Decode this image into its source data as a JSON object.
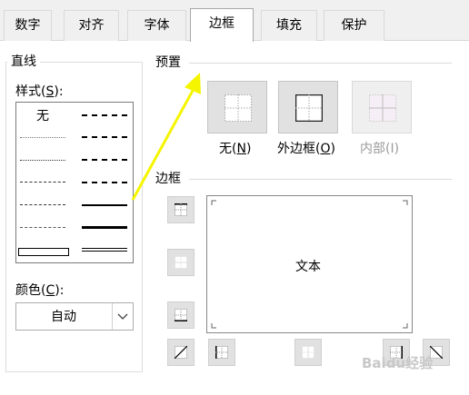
{
  "tabs": [
    {
      "label": "数字"
    },
    {
      "label": "对齐"
    },
    {
      "label": "字体"
    },
    {
      "label": "边框"
    },
    {
      "label": "填充"
    },
    {
      "label": "保护"
    }
  ],
  "active_tab": "边框",
  "line_group": {
    "title": "直线",
    "style_label": "样式",
    "style_key": "S",
    "none_label": "无",
    "color_label": "颜色",
    "color_key": "C",
    "color_value": "自动"
  },
  "presets": {
    "title": "预置",
    "items": [
      {
        "label": "无",
        "key": "N",
        "enabled": true
      },
      {
        "label": "外边框",
        "key": "O",
        "enabled": true
      },
      {
        "label": "内部",
        "key": "I",
        "enabled": false
      }
    ]
  },
  "border": {
    "title": "边框",
    "preview_text": "文本"
  },
  "watermark": "Baidu经验",
  "colors": {
    "arrow": "#f5f500",
    "button_bg": "#e1e1e1",
    "active_tab_border": "#a8a8a8"
  }
}
